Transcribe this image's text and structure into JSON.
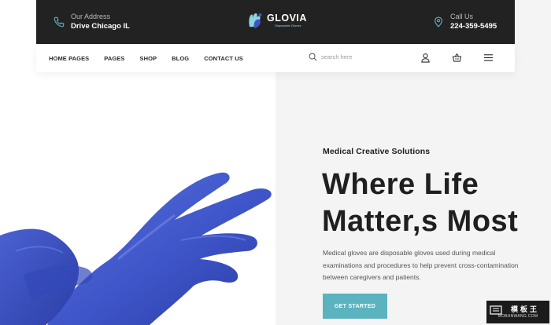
{
  "topbar": {
    "address": {
      "label": "Our Address",
      "value": "Drive Chicago IL",
      "icon": "phone-icon"
    },
    "call": {
      "label": "Call Us",
      "value": "224-359-5495",
      "icon": "location-pin-icon"
    },
    "brand": {
      "name": "GLOVIA",
      "tagline": "Disposable Gloves",
      "icon": "glove-logo-icon"
    }
  },
  "nav": {
    "items": [
      {
        "label": "HOME PAGES"
      },
      {
        "label": "PAGES"
      },
      {
        "label": "SHOP"
      },
      {
        "label": "BLOG"
      },
      {
        "label": "CONTACT US"
      }
    ],
    "search": {
      "placeholder": "search here",
      "icon": "search-icon"
    },
    "icons": [
      "user-icon",
      "cart-basket-icon",
      "hamburger-menu-icon"
    ]
  },
  "hero": {
    "eyebrow": "Medical Creative Solutions",
    "headline_line1": "Where Life",
    "headline_line2": "Matter,s Most",
    "description": "Medical gloves are disposable gloves used during medical examinations and procedures to help prevent cross-contamination between caregivers and patients.",
    "cta": "GET STARTED",
    "image": "blue-medical-glove-hands"
  },
  "watermark": {
    "title": "模板王",
    "url": "MOBANWANG.COM"
  },
  "colors": {
    "topbar": "#222222",
    "accent": "#5bb3bf",
    "glove": "#3e55c9",
    "hero_right_bg": "#f4f4f4"
  }
}
